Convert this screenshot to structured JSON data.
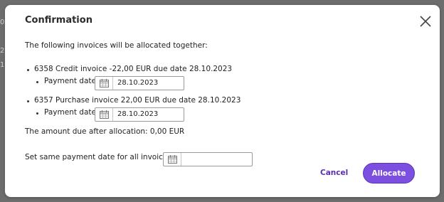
{
  "dialog": {
    "title": "Confirmation",
    "intro": "The following invoices will be allocated together:",
    "invoices": [
      {
        "description": "6358 Credit invoice -22,00 EUR due date 28.10.2023",
        "payment_label": "Payment date",
        "payment_date": "28.10.2023"
      },
      {
        "description": "6357 Purchase invoice 22,00 EUR due date 28.10.2023",
        "payment_label": "Payment date",
        "payment_date": "28.10.2023"
      }
    ],
    "amount_due": "The amount due after allocation: 0,00 EUR",
    "same_date_label": "Set same payment date for all invoices",
    "same_date_value": "",
    "cancel_label": "Cancel",
    "allocate_label": "Allocate"
  },
  "icons": {
    "close": "close-icon",
    "calendar": "calendar-icon"
  },
  "colors": {
    "accent": "#7c4fe0",
    "cancel": "#5b2fb0",
    "overlay": "#6d6d6d"
  }
}
